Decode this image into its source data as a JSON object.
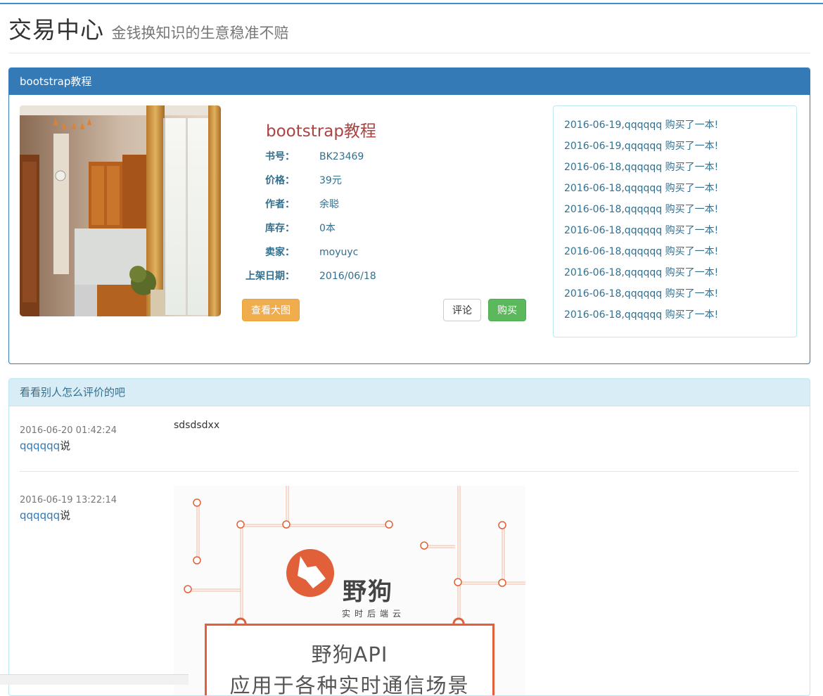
{
  "header": {
    "title": "交易中心",
    "subtitle": "金钱换知识的生意稳准不赔"
  },
  "book_panel": {
    "heading": "bootstrap教程",
    "book_title": "bootstrap教程",
    "fields": [
      {
        "label": "书号：",
        "value": "BK23469"
      },
      {
        "label": "价格：",
        "value": "39元"
      },
      {
        "label": "作者：",
        "value": "余聪"
      },
      {
        "label": "库存：",
        "value": "0本"
      },
      {
        "label": "卖家：",
        "value": "moyuyc"
      },
      {
        "label": "上架日期：",
        "value": "2016/06/18"
      }
    ],
    "buttons": {
      "view_large": "查看大图",
      "comment": "评论",
      "buy": "购买"
    },
    "purchase_log": [
      "2016-06-19,qqqqqq 购买了一本!",
      "2016-06-19,qqqqqq 购买了一本!",
      "2016-06-18,qqqqqq 购买了一本!",
      "2016-06-18,qqqqqq 购买了一本!",
      "2016-06-18,qqqqqq 购买了一本!",
      "2016-06-18,qqqqqq 购买了一本!",
      "2016-06-18,qqqqqq 购买了一本!",
      "2016-06-18,qqqqqq 购买了一本!",
      "2016-06-18,qqqqqq 购买了一本!",
      "2016-06-18,qqqqqq 购买了一本!"
    ]
  },
  "comments_panel": {
    "heading": "看看别人怎么评价的吧",
    "comments": [
      {
        "date": "2016-06-20 01:42:24",
        "user": "qqqqqq",
        "said": "说",
        "text": "sdsdsdxx"
      },
      {
        "date": "2016-06-19 13:22:14",
        "user": "qqqqqq",
        "said": "说",
        "text": ""
      }
    ],
    "ad": {
      "logo": "野狗",
      "logo_sub": "实时后端云",
      "line1": "野狗API",
      "line2": "应用于各种实时通信场景"
    }
  },
  "colors": {
    "primary": "#337ab7",
    "warning": "#f0ad4e",
    "success": "#5cb85c",
    "danger_text": "#a94442",
    "info_text": "#31708f",
    "ad_accent": "#e1603a"
  }
}
